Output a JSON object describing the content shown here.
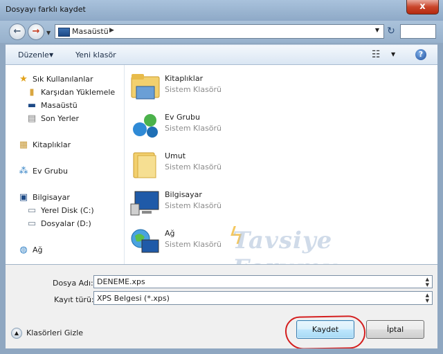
{
  "window": {
    "title": "Dosyayı farklı kaydet",
    "close_label": "x"
  },
  "nav": {
    "back_glyph": "←",
    "forward_glyph": "→",
    "address_location": "Masaüstü",
    "refresh_glyph": "↻"
  },
  "toolbar": {
    "organize_label": "Düzenle",
    "new_folder_label": "Yeni klasör",
    "help_glyph": "?"
  },
  "sidebar": {
    "favorites_label": "Sık Kullanılanlar",
    "favorites_items": [
      "Karşıdan Yüklemeler",
      "Masaüstü",
      "Son Yerler"
    ],
    "libraries_label": "Kitaplıklar",
    "homegroup_label": "Ev Grubu",
    "computer_label": "Bilgisayar",
    "computer_items": [
      "Yerel Disk (C:)",
      "Dosyalar (D:)"
    ],
    "network_label": "Ağ"
  },
  "content": {
    "items": [
      {
        "name": "Kitaplıklar",
        "type": "Sistem Klasörü"
      },
      {
        "name": "Ev Grubu",
        "type": "Sistem Klasörü"
      },
      {
        "name": "Umut",
        "type": "Sistem Klasörü"
      },
      {
        "name": "Bilgisayar",
        "type": "Sistem Klasörü"
      },
      {
        "name": "Ağ",
        "type": "Sistem Klasörü"
      }
    ],
    "watermark": "Tavsiye Forumu"
  },
  "form": {
    "file_name_label": "Dosya Adı:",
    "file_name_value": "DENEME.xps",
    "file_type_label": "Kayıt türü:",
    "file_type_value": "XPS Belgesi (*.xps)"
  },
  "footer": {
    "hide_folders_label": "Klasörleri Gizle",
    "save_label": "Kaydet",
    "cancel_label": "İptal"
  },
  "colors": {
    "annotation": "#d41e1e",
    "frame": "#8fa7c1"
  }
}
